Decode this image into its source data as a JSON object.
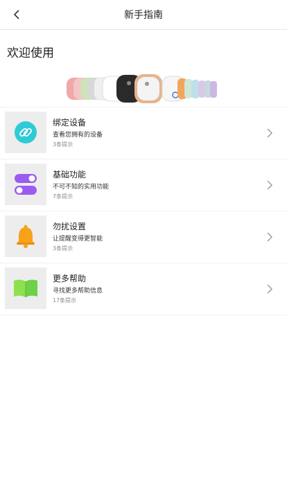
{
  "header": {
    "title": "新手指南"
  },
  "welcome": "欢迎使用",
  "guides": [
    {
      "name": "绑定设备",
      "desc": "查看您拥有的设备",
      "count": "3条提示",
      "icon": "link-icon"
    },
    {
      "name": "基础功能",
      "desc": "不可不知的实用功能",
      "count": "7条提示",
      "icon": "toggle-icon"
    },
    {
      "name": "勿扰设置",
      "desc": "让提醒变得更智能",
      "count": "3条提示",
      "icon": "bell-icon"
    },
    {
      "name": "更多帮助",
      "desc": "寻找更多帮助信息",
      "count": "17条提示",
      "icon": "book-icon"
    }
  ],
  "colors": {
    "link": "#2ecbd6",
    "toggle": "#9b5bf0",
    "bell": "#f6a21a",
    "book": "#8ee04c"
  }
}
